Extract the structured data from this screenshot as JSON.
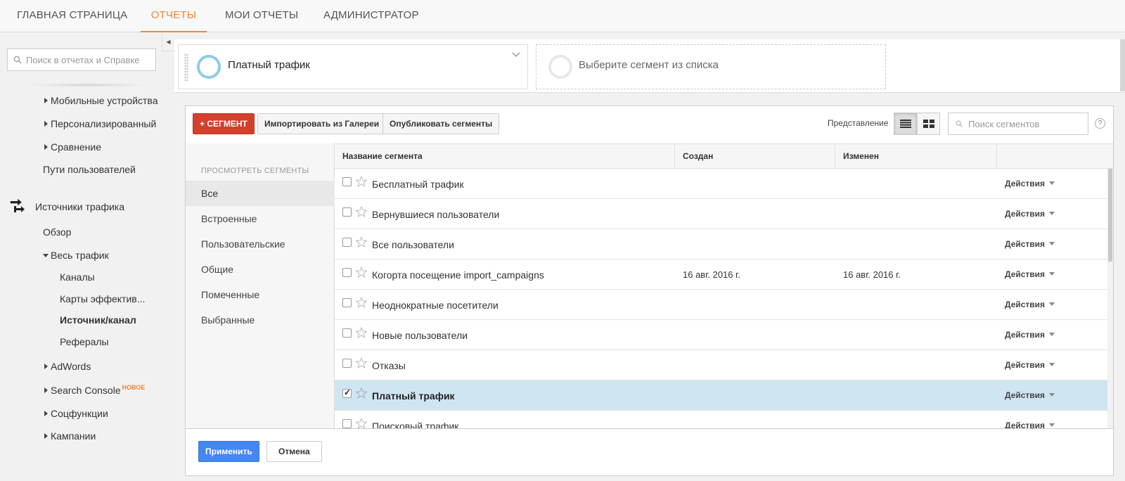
{
  "topnav": {
    "items": [
      "ГЛАВНАЯ СТРАНИЦА",
      "ОТЧЕТЫ",
      "МОИ ОТЧЕТЫ",
      "АДМИНИСТРАТОР"
    ],
    "active_index": 1
  },
  "sidebar": {
    "search_placeholder": "Поиск в отчетах и Справке",
    "items": {
      "mobile": "Мобильные устройства",
      "custom": "Персонализированный",
      "compare": "Сравнение",
      "user_paths": "Пути пользователей",
      "traffic_sources": "Источники трафика",
      "overview": "Обзор",
      "all_traffic": "Весь трафик",
      "channels": "Каналы",
      "treemaps": "Карты эффектив...",
      "source_medium": "Источник/канал",
      "referrals": "Рефералы",
      "adwords": "AdWords",
      "search_console": "Search Console",
      "search_console_badge": "НОВОЕ",
      "social": "Соцфункции",
      "campaigns": "Кампании"
    }
  },
  "segment_bar": {
    "active_segment": "Платный трафик",
    "empty_slot": "Выберите сегмент из списка"
  },
  "toolbar": {
    "add_segment": "+ СЕГМЕНТ",
    "import_gallery": "Импортировать из Галереи",
    "share_segments": "Опубликовать сегменты",
    "view_label": "Представление",
    "search_placeholder": "Поиск сегментов",
    "help": "?"
  },
  "categories": {
    "heading": "ПРОСМОТРЕТЬ СЕГМЕНТЫ",
    "items": [
      "Все",
      "Встроенные",
      "Пользовательские",
      "Общие",
      "Помеченные",
      "Выбранные"
    ],
    "active_index": 0
  },
  "table": {
    "headers": {
      "name": "Название сегмента",
      "created": "Создан",
      "modified": "Изменен"
    },
    "actions_label": "Действия",
    "rows": [
      {
        "name": "Бесплатный трафик",
        "created": "",
        "modified": "",
        "checked": false
      },
      {
        "name": "Вернувшиеся пользователи",
        "created": "",
        "modified": "",
        "checked": false
      },
      {
        "name": "Все пользователи",
        "created": "",
        "modified": "",
        "checked": false
      },
      {
        "name": "Когорта посещение import_campaigns",
        "created": "16 авг. 2016 г.",
        "modified": "16 авг. 2016 г.",
        "checked": false
      },
      {
        "name": "Неоднократные посетители",
        "created": "",
        "modified": "",
        "checked": false
      },
      {
        "name": "Новые пользователи",
        "created": "",
        "modified": "",
        "checked": false
      },
      {
        "name": "Отказы",
        "created": "",
        "modified": "",
        "checked": false
      },
      {
        "name": "Платный трафик",
        "created": "",
        "modified": "",
        "checked": true
      },
      {
        "name": "Поисковый трафик",
        "created": "",
        "modified": "",
        "checked": false
      }
    ]
  },
  "footer": {
    "apply": "Применить",
    "cancel": "Отмена"
  },
  "colors": {
    "accent_orange": "#f58634",
    "add_button_red": "#d3402b",
    "apply_button_blue": "#4487f2",
    "selected_row": "#cfe6f2",
    "segment_ring": "#8dcce7"
  }
}
